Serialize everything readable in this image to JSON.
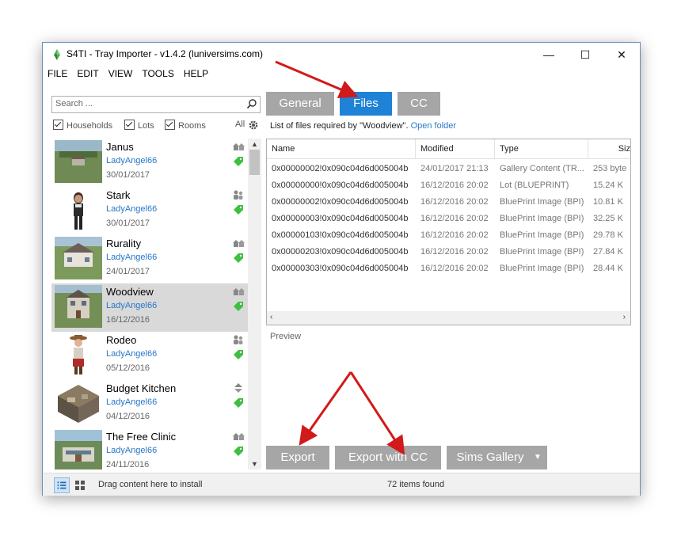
{
  "window": {
    "title": "S4TI - Tray Importer - v1.4.2  (luniversims.com)",
    "controls": {
      "minimize": "—",
      "maximize": "☐",
      "close": "✕"
    }
  },
  "menu": [
    "FILE",
    "EDIT",
    "VIEW",
    "TOOLS",
    "HELP"
  ],
  "search": {
    "placeholder": "Search ..."
  },
  "filters": {
    "households": "Households",
    "lots": "Lots",
    "rooms": "Rooms",
    "all": "All"
  },
  "items": [
    {
      "name": "Janus",
      "author": "LadyAngel66",
      "date": "30/01/2017",
      "kind": "lot"
    },
    {
      "name": "Stark",
      "author": "LadyAngel66",
      "date": "30/01/2017",
      "kind": "household"
    },
    {
      "name": "Rurality",
      "author": "LadyAngel66",
      "date": "24/01/2017",
      "kind": "lot"
    },
    {
      "name": "Woodview",
      "author": "LadyAngel66",
      "date": "16/12/2016",
      "kind": "lot"
    },
    {
      "name": "Rodeo",
      "author": "LadyAngel66",
      "date": "05/12/2016",
      "kind": "household"
    },
    {
      "name": "Budget Kitchen",
      "author": "LadyAngel66",
      "date": "04/12/2016",
      "kind": "room"
    },
    {
      "name": "The Free Clinic",
      "author": "LadyAngel66",
      "date": "24/11/2016",
      "kind": "lot"
    }
  ],
  "tabs": {
    "general": "General",
    "files": "Files",
    "cc": "CC"
  },
  "files": {
    "caption": "List of files required by \"Woodview\".",
    "open_folder": "Open folder",
    "columns": [
      "Name",
      "Modified",
      "Type",
      "Siz"
    ],
    "rows": [
      [
        "0x00000002!0x090c04d6d005004b",
        "24/01/2017 21:13",
        "Gallery Content (TR...",
        "253 byte"
      ],
      [
        "0x00000000!0x090c04d6d005004b",
        "16/12/2016 20:02",
        "Lot (BLUEPRINT)",
        "15.24 K"
      ],
      [
        "0x00000002!0x090c04d6d005004b",
        "16/12/2016 20:02",
        "BluePrint Image (BPI)",
        "10.81 K"
      ],
      [
        "0x00000003!0x090c04d6d005004b",
        "16/12/2016 20:02",
        "BluePrint Image (BPI)",
        "32.25 K"
      ],
      [
        "0x00000103!0x090c04d6d005004b",
        "16/12/2016 20:02",
        "BluePrint Image (BPI)",
        "29.78 K"
      ],
      [
        "0x00000203!0x090c04d6d005004b",
        "16/12/2016 20:02",
        "BluePrint Image (BPI)",
        "27.84 K"
      ],
      [
        "0x00000303!0x090c04d6d005004b",
        "16/12/2016 20:02",
        "BluePrint Image (BPI)",
        "28.44 K"
      ]
    ]
  },
  "preview": {
    "label": "Preview"
  },
  "buttons": {
    "export": "Export",
    "export_cc": "Export with CC",
    "gallery": "Sims Gallery"
  },
  "status": {
    "hint": "Drag content here to install",
    "count": "72 items found"
  },
  "colors": {
    "accent": "#1e82d6",
    "button_grey": "#a6a6a6",
    "link": "#2a78c8",
    "tag_green": "#3fbf3f",
    "annotation_red": "#d21a1a"
  }
}
